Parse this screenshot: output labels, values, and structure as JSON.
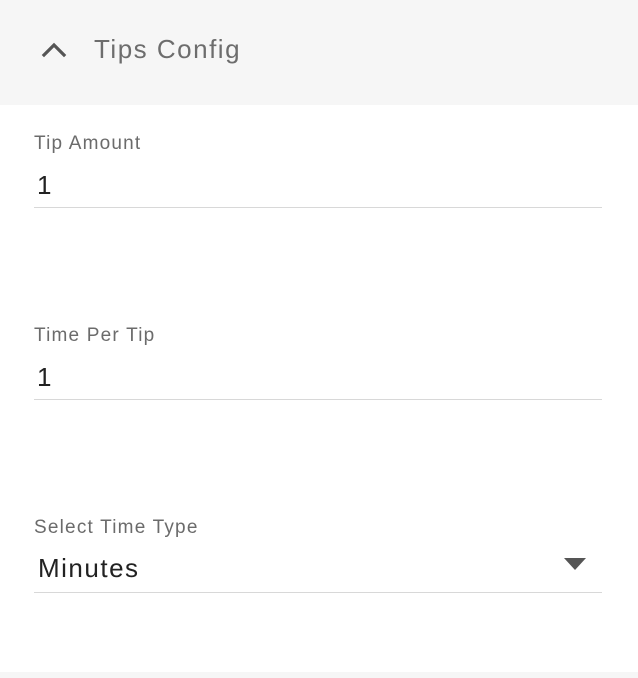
{
  "panel": {
    "title": "Tips Config",
    "expanded": true,
    "header_bg": "#f6f6f6",
    "toggle_icon": "chevron-up-icon"
  },
  "fields": {
    "tip_amount": {
      "label": "Tip Amount",
      "value": "1"
    },
    "time_per_tip": {
      "label": "Time Per Tip",
      "value": "1"
    },
    "time_type": {
      "label": "Select Time Type",
      "selected": "Minutes",
      "caret_icon": "caret-down-icon"
    }
  }
}
